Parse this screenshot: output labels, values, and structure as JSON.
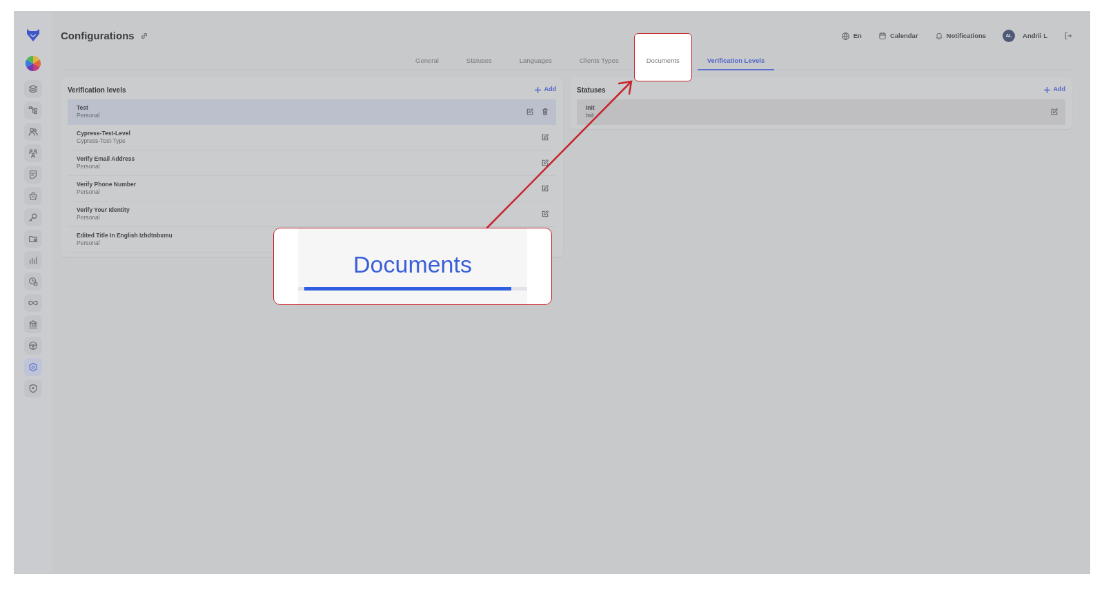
{
  "sidebar": {
    "items": [
      {
        "kind": "layers",
        "selected": false
      },
      {
        "kind": "hierarchy",
        "selected": false
      },
      {
        "kind": "users",
        "selected": false
      },
      {
        "kind": "group",
        "selected": false
      },
      {
        "kind": "note",
        "selected": false
      },
      {
        "kind": "basket",
        "selected": false
      },
      {
        "kind": "key",
        "selected": false
      },
      {
        "kind": "folder",
        "selected": false
      },
      {
        "kind": "chart",
        "selected": false
      },
      {
        "kind": "clock",
        "selected": false
      },
      {
        "kind": "infinity",
        "selected": false
      },
      {
        "kind": "bank",
        "selected": false
      },
      {
        "kind": "wheel",
        "selected": false
      },
      {
        "kind": "gear",
        "selected": true
      },
      {
        "kind": "shield",
        "selected": false
      }
    ]
  },
  "header": {
    "title": "Configurations",
    "language": "En",
    "calendar": "Calendar",
    "notifications": "Notifications",
    "user": {
      "initials": "AL",
      "name": "Andrii L"
    }
  },
  "tabs": [
    {
      "label": "General",
      "selected": false,
      "highlighted": false
    },
    {
      "label": "Statuses",
      "selected": false,
      "highlighted": false
    },
    {
      "label": "Languages",
      "selected": false,
      "highlighted": false
    },
    {
      "label": "Clients Types",
      "selected": false,
      "highlighted": false
    },
    {
      "label": "Documents",
      "selected": false,
      "highlighted": true
    },
    {
      "label": "Verification Levels",
      "selected": true,
      "highlighted": false
    }
  ],
  "verification_levels": {
    "title": "Verification levels",
    "add_label": "Add",
    "rows": [
      {
        "title": "Test",
        "subtitle": "Personal",
        "selected": true,
        "editable": true,
        "deletable": true
      },
      {
        "title": "Cypress-Test-Level",
        "subtitle": "Cypress-Test-Type",
        "selected": false,
        "editable": true,
        "deletable": false
      },
      {
        "title": "Verify Email Address",
        "subtitle": "Personal",
        "selected": false,
        "editable": true,
        "deletable": false
      },
      {
        "title": "Verify Phone Number",
        "subtitle": "Personal",
        "selected": false,
        "editable": true,
        "deletable": false
      },
      {
        "title": "Verify Your Identity",
        "subtitle": "Personal",
        "selected": false,
        "editable": true,
        "deletable": false
      },
      {
        "title": "Edited Title In English Izhdtnbxmu",
        "subtitle": "Personal",
        "selected": false
      }
    ]
  },
  "statuses": {
    "title": "Statuses",
    "add_label": "Add",
    "rows": [
      {
        "title": "Init",
        "subtitle": "Init",
        "selected": true,
        "editable": true,
        "deletable": false
      }
    ]
  },
  "callout": {
    "text": "Documents"
  }
}
